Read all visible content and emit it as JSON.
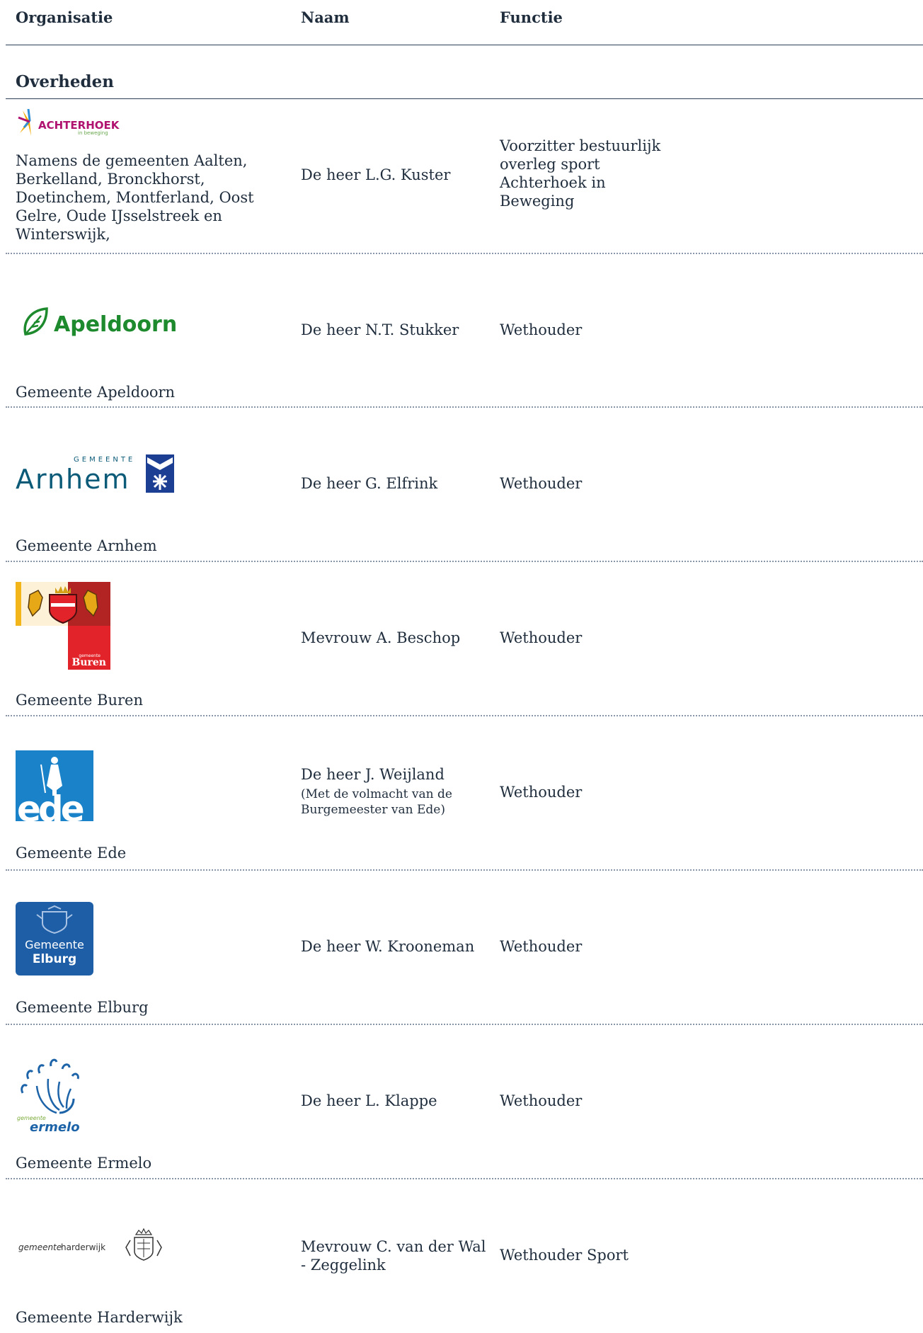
{
  "table": {
    "headers": {
      "org": "Organisatie",
      "naam": "Naam",
      "functie": "Functie"
    },
    "section": "Overheden",
    "rows": [
      {
        "logo": {
          "name": "achterhoek-logo",
          "text": "ACHTERHOEK",
          "subtext": "in beweging"
        },
        "org": "Namens de gemeenten Aalten, Berkelland, Bronckhorst, Doetinchem, Montferland, Oost Gelre, Oude IJsselstreek en Winterswijk,",
        "naam": "De heer L.G. Kuster",
        "functie": "Voorzitter bestuurlijk overleg sport Achterhoek in Beweging"
      },
      {
        "logo": {
          "name": "apeldoorn-logo",
          "text": "Apeldoorn"
        },
        "org": "Gemeente Apeldoorn",
        "naam": "De heer N.T. Stukker",
        "functie": "Wethouder"
      },
      {
        "logo": {
          "name": "arnhem-logo",
          "text": "Arnhem",
          "subtext": "GEMEENTE"
        },
        "org": "Gemeente Arnhem",
        "naam": "De heer G. Elfrink",
        "functie": "Wethouder"
      },
      {
        "logo": {
          "name": "buren-logo",
          "text": "Buren",
          "subtext": "gemeente"
        },
        "org": "Gemeente Buren",
        "naam": "Mevrouw A. Beschop",
        "functie": "Wethouder"
      },
      {
        "logo": {
          "name": "ede-logo",
          "text": "ede"
        },
        "org": "Gemeente Ede",
        "naam": "De heer J. Weijland",
        "naam_note": "(Met de volmacht van de Burgemeester van Ede)",
        "functie": "Wethouder"
      },
      {
        "logo": {
          "name": "elburg-logo",
          "text": "Gemeente",
          "subtext": "Elburg"
        },
        "org": "Gemeente Elburg",
        "naam": "De heer W. Krooneman",
        "functie": "Wethouder"
      },
      {
        "logo": {
          "name": "ermelo-logo",
          "text": "ermelo",
          "subtext": "gemeente"
        },
        "org": "Gemeente Ermelo",
        "naam": "De heer L. Klappe",
        "functie": "Wethouder"
      },
      {
        "logo": {
          "name": "harderwijk-logo",
          "text": "harderwijk",
          "subtext": "gemeente"
        },
        "org": "Gemeente Harderwijk",
        "naam": "Mevrouw C. van der Wal - Zeggelink",
        "functie": "Wethouder Sport"
      }
    ]
  },
  "colors": {
    "text": "#1f2d3d",
    "rule": "#2b3f56",
    "dots": "#8a96a8",
    "apeldoorn": "#1e8a2e",
    "arnhem": "#0a5a78",
    "ede": "#1a82c8",
    "elburg": "#1e5ea6",
    "buren_red": "#e3232a",
    "buren_dark": "#b22323",
    "ermelo": "#1d63a8",
    "achterhoek": "#b0126f"
  }
}
